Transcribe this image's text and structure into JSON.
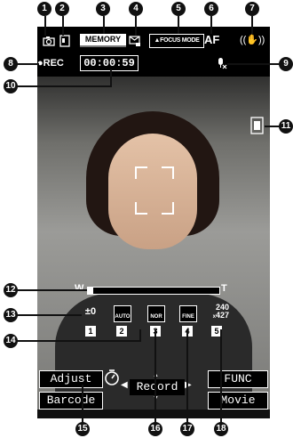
{
  "top_bar": {
    "memory_label": "MEMORY",
    "focus_mode_label": "FOCUS MODE",
    "af_label": "AF"
  },
  "rec": {
    "label": "REC",
    "timer": "00:00:59"
  },
  "zoom": {
    "wide_label": "W",
    "tele_label": "T"
  },
  "settings": {
    "exposure_value": "±0",
    "size_top": "240",
    "size_bottom": "427",
    "size_prefix": "x",
    "white_balance_label": "AUTO",
    "scene_label": "NOR",
    "quality_label": "FINE",
    "key_numbers": [
      "1",
      "2",
      "3",
      "4",
      "5"
    ]
  },
  "softkeys": {
    "adjust": "Adjust",
    "barcode": "Barcode",
    "record": "Record",
    "func": "FUNC",
    "movie": "Movie"
  },
  "callouts": [
    "1",
    "2",
    "3",
    "4",
    "5",
    "6",
    "7",
    "8",
    "9",
    "10",
    "11",
    "12",
    "13",
    "14",
    "15",
    "16",
    "17",
    "18"
  ]
}
